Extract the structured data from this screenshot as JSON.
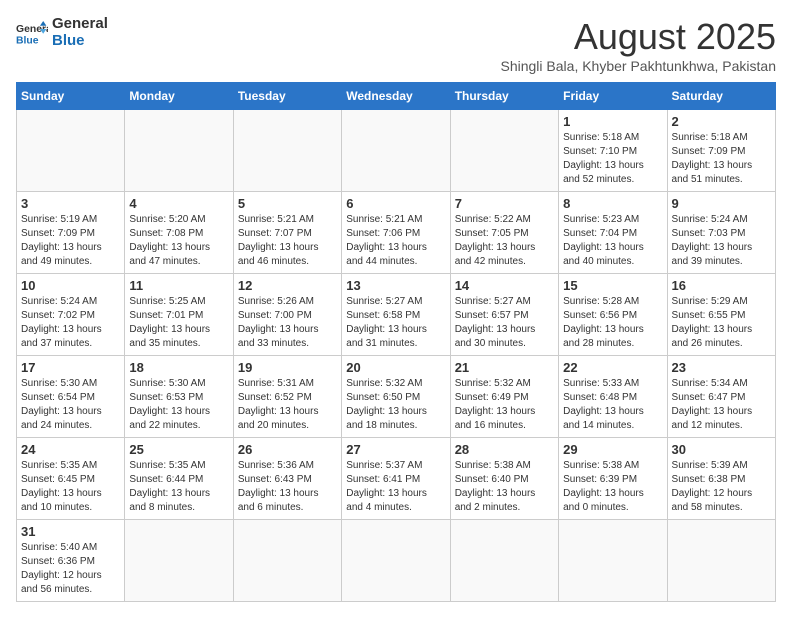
{
  "header": {
    "logo_general": "General",
    "logo_blue": "Blue",
    "month_title": "August 2025",
    "location": "Shingli Bala, Khyber Pakhtunkhwa, Pakistan"
  },
  "weekdays": [
    "Sunday",
    "Monday",
    "Tuesday",
    "Wednesday",
    "Thursday",
    "Friday",
    "Saturday"
  ],
  "weeks": [
    [
      {
        "day": "",
        "info": ""
      },
      {
        "day": "",
        "info": ""
      },
      {
        "day": "",
        "info": ""
      },
      {
        "day": "",
        "info": ""
      },
      {
        "day": "",
        "info": ""
      },
      {
        "day": "1",
        "info": "Sunrise: 5:18 AM\nSunset: 7:10 PM\nDaylight: 13 hours\nand 52 minutes."
      },
      {
        "day": "2",
        "info": "Sunrise: 5:18 AM\nSunset: 7:09 PM\nDaylight: 13 hours\nand 51 minutes."
      }
    ],
    [
      {
        "day": "3",
        "info": "Sunrise: 5:19 AM\nSunset: 7:09 PM\nDaylight: 13 hours\nand 49 minutes."
      },
      {
        "day": "4",
        "info": "Sunrise: 5:20 AM\nSunset: 7:08 PM\nDaylight: 13 hours\nand 47 minutes."
      },
      {
        "day": "5",
        "info": "Sunrise: 5:21 AM\nSunset: 7:07 PM\nDaylight: 13 hours\nand 46 minutes."
      },
      {
        "day": "6",
        "info": "Sunrise: 5:21 AM\nSunset: 7:06 PM\nDaylight: 13 hours\nand 44 minutes."
      },
      {
        "day": "7",
        "info": "Sunrise: 5:22 AM\nSunset: 7:05 PM\nDaylight: 13 hours\nand 42 minutes."
      },
      {
        "day": "8",
        "info": "Sunrise: 5:23 AM\nSunset: 7:04 PM\nDaylight: 13 hours\nand 40 minutes."
      },
      {
        "day": "9",
        "info": "Sunrise: 5:24 AM\nSunset: 7:03 PM\nDaylight: 13 hours\nand 39 minutes."
      }
    ],
    [
      {
        "day": "10",
        "info": "Sunrise: 5:24 AM\nSunset: 7:02 PM\nDaylight: 13 hours\nand 37 minutes."
      },
      {
        "day": "11",
        "info": "Sunrise: 5:25 AM\nSunset: 7:01 PM\nDaylight: 13 hours\nand 35 minutes."
      },
      {
        "day": "12",
        "info": "Sunrise: 5:26 AM\nSunset: 7:00 PM\nDaylight: 13 hours\nand 33 minutes."
      },
      {
        "day": "13",
        "info": "Sunrise: 5:27 AM\nSunset: 6:58 PM\nDaylight: 13 hours\nand 31 minutes."
      },
      {
        "day": "14",
        "info": "Sunrise: 5:27 AM\nSunset: 6:57 PM\nDaylight: 13 hours\nand 30 minutes."
      },
      {
        "day": "15",
        "info": "Sunrise: 5:28 AM\nSunset: 6:56 PM\nDaylight: 13 hours\nand 28 minutes."
      },
      {
        "day": "16",
        "info": "Sunrise: 5:29 AM\nSunset: 6:55 PM\nDaylight: 13 hours\nand 26 minutes."
      }
    ],
    [
      {
        "day": "17",
        "info": "Sunrise: 5:30 AM\nSunset: 6:54 PM\nDaylight: 13 hours\nand 24 minutes."
      },
      {
        "day": "18",
        "info": "Sunrise: 5:30 AM\nSunset: 6:53 PM\nDaylight: 13 hours\nand 22 minutes."
      },
      {
        "day": "19",
        "info": "Sunrise: 5:31 AM\nSunset: 6:52 PM\nDaylight: 13 hours\nand 20 minutes."
      },
      {
        "day": "20",
        "info": "Sunrise: 5:32 AM\nSunset: 6:50 PM\nDaylight: 13 hours\nand 18 minutes."
      },
      {
        "day": "21",
        "info": "Sunrise: 5:32 AM\nSunset: 6:49 PM\nDaylight: 13 hours\nand 16 minutes."
      },
      {
        "day": "22",
        "info": "Sunrise: 5:33 AM\nSunset: 6:48 PM\nDaylight: 13 hours\nand 14 minutes."
      },
      {
        "day": "23",
        "info": "Sunrise: 5:34 AM\nSunset: 6:47 PM\nDaylight: 13 hours\nand 12 minutes."
      }
    ],
    [
      {
        "day": "24",
        "info": "Sunrise: 5:35 AM\nSunset: 6:45 PM\nDaylight: 13 hours\nand 10 minutes."
      },
      {
        "day": "25",
        "info": "Sunrise: 5:35 AM\nSunset: 6:44 PM\nDaylight: 13 hours\nand 8 minutes."
      },
      {
        "day": "26",
        "info": "Sunrise: 5:36 AM\nSunset: 6:43 PM\nDaylight: 13 hours\nand 6 minutes."
      },
      {
        "day": "27",
        "info": "Sunrise: 5:37 AM\nSunset: 6:41 PM\nDaylight: 13 hours\nand 4 minutes."
      },
      {
        "day": "28",
        "info": "Sunrise: 5:38 AM\nSunset: 6:40 PM\nDaylight: 13 hours\nand 2 minutes."
      },
      {
        "day": "29",
        "info": "Sunrise: 5:38 AM\nSunset: 6:39 PM\nDaylight: 13 hours\nand 0 minutes."
      },
      {
        "day": "30",
        "info": "Sunrise: 5:39 AM\nSunset: 6:38 PM\nDaylight: 12 hours\nand 58 minutes."
      }
    ],
    [
      {
        "day": "31",
        "info": "Sunrise: 5:40 AM\nSunset: 6:36 PM\nDaylight: 12 hours\nand 56 minutes."
      },
      {
        "day": "",
        "info": ""
      },
      {
        "day": "",
        "info": ""
      },
      {
        "day": "",
        "info": ""
      },
      {
        "day": "",
        "info": ""
      },
      {
        "day": "",
        "info": ""
      },
      {
        "day": "",
        "info": ""
      }
    ]
  ]
}
